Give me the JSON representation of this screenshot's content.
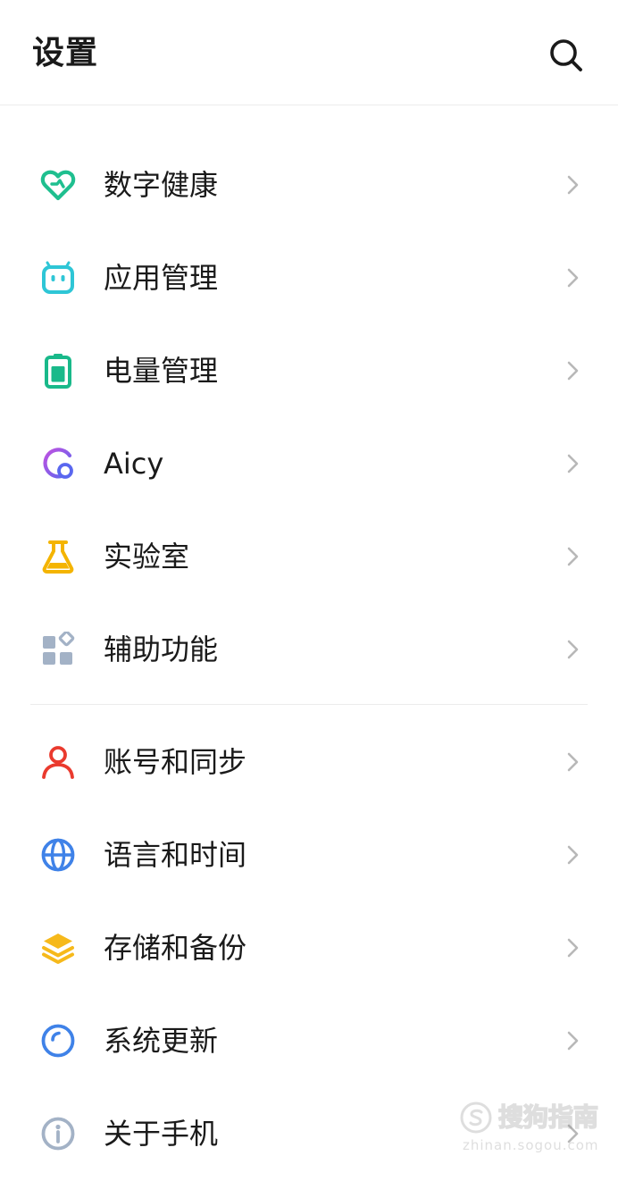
{
  "header": {
    "title": "设置",
    "search_icon": "search-icon"
  },
  "groups": [
    {
      "items": [
        {
          "label": "数字健康",
          "icon": "heart-icon",
          "color": "#1fbf8f"
        },
        {
          "label": "应用管理",
          "icon": "android-icon",
          "color": "#2ec6d6"
        },
        {
          "label": "电量管理",
          "icon": "battery-icon",
          "color": "#19b98a"
        },
        {
          "label": "Aicy",
          "icon": "aicy-icon",
          "color": "#7a5cf0"
        },
        {
          "label": "实验室",
          "icon": "flask-icon",
          "color": "#f4b400"
        },
        {
          "label": "辅助功能",
          "icon": "grid-icon",
          "color": "#a3b2c6"
        }
      ]
    },
    {
      "items": [
        {
          "label": "账号和同步",
          "icon": "person-icon",
          "color": "#ea3a2e"
        },
        {
          "label": "语言和时间",
          "icon": "globe-icon",
          "color": "#3f82e8"
        },
        {
          "label": "存储和备份",
          "icon": "layers-icon",
          "color": "#f6b91b"
        },
        {
          "label": "系统更新",
          "icon": "update-icon",
          "color": "#3f82e8"
        },
        {
          "label": "关于手机",
          "icon": "info-icon",
          "color": "#a3b2c6"
        }
      ]
    }
  ],
  "watermark": {
    "main": "搜狗指南",
    "sub": "zhinan.sogou.com"
  }
}
